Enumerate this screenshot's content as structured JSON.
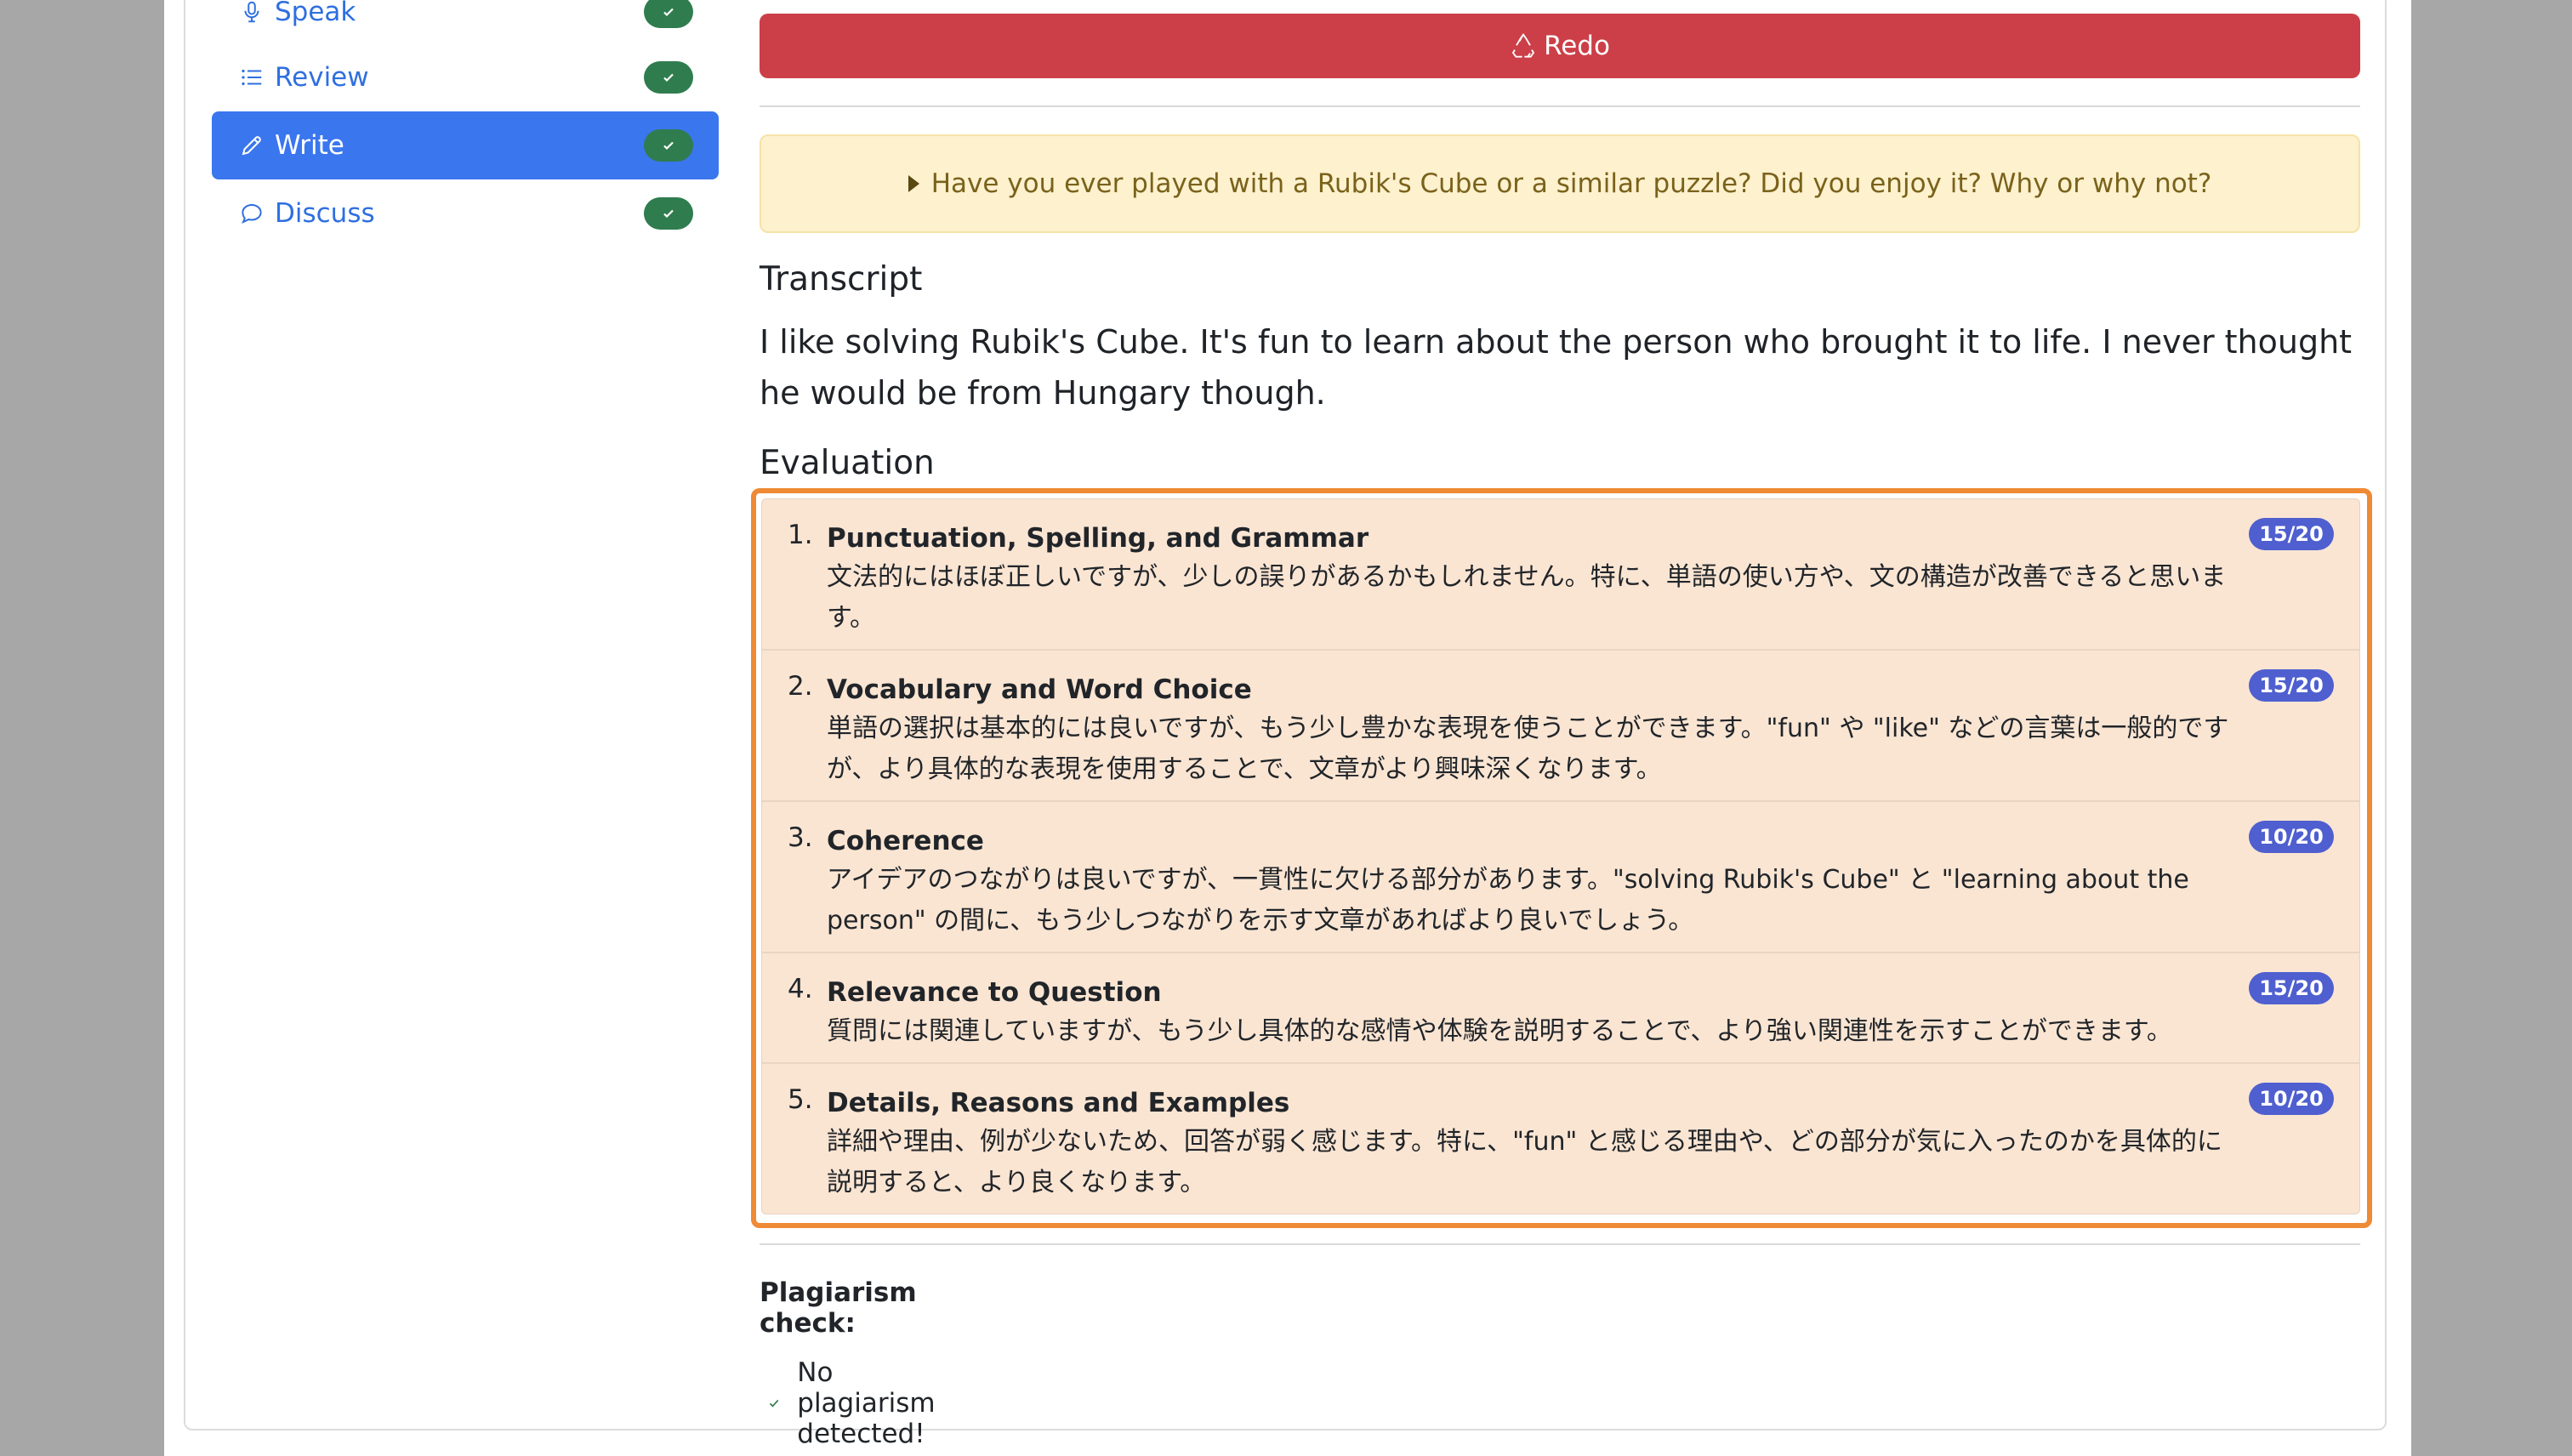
{
  "sidebar": {
    "items": [
      {
        "label": "Speak",
        "icon": "microphone-icon",
        "done": true
      },
      {
        "label": "Review",
        "icon": "list-icon",
        "done": true
      },
      {
        "label": "Write",
        "icon": "pencil-icon",
        "done": true,
        "active": true
      },
      {
        "label": "Discuss",
        "icon": "chat-bubble-icon",
        "done": true
      }
    ]
  },
  "main": {
    "redo_label": "Redo",
    "question": "Have you ever played with a Rubik's Cube or a similar puzzle? Did you enjoy it? Why or why not?",
    "transcript_heading": "Transcript",
    "transcript_text": "I like solving Rubik's Cube. It's fun to learn about the person who brought it to life. I never thought he would be from Hungary though.",
    "evaluation_heading": "Evaluation",
    "evaluation": [
      {
        "num": "1.",
        "title": "Punctuation, Spelling, and Grammar",
        "body": "文法的にはほぼ正しいですが、少しの誤りがあるかもしれません。特に、単語の使い方や、文の構造が改善できると思います。",
        "score": "15/20"
      },
      {
        "num": "2.",
        "title": "Vocabulary and Word Choice",
        "body": "単語の選択は基本的には良いですが、もう少し豊かな表現を使うことができます。\"fun\" や \"like\" などの言葉は一般的ですが、より具体的な表現を使用することで、文章がより興味深くなります。",
        "score": "15/20"
      },
      {
        "num": "3.",
        "title": "Coherence",
        "body": "アイデアのつながりは良いですが、一貫性に欠ける部分があります。\"solving Rubik's Cube\" と \"learning about the person\" の間に、もう少しつながりを示す文章があればより良いでしょう。",
        "score": "10/20"
      },
      {
        "num": "4.",
        "title": "Relevance to Question",
        "body": "質問には関連していますが、もう少し具体的な感情や体験を説明することで、より強い関連性を示すことができます。",
        "score": "15/20"
      },
      {
        "num": "5.",
        "title": "Details, Reasons and Examples",
        "body": "詳細や理由、例が少ないため、回答が弱く感じます。特に、\"fun\" と感じる理由や、どの部分が気に入ったのかを具体的に説明すると、より良くなります。",
        "score": "10/20"
      }
    ],
    "plagiarism_label": "Plagiarism check:",
    "plagiarism_result": "No plagiarism detected!"
  },
  "colors": {
    "active_nav": "#3a76ee",
    "redo": "#cc3f48",
    "highlight": "#ef8a35",
    "score_badge": "#4f5fcf",
    "done_pill": "#2f7d4f"
  }
}
